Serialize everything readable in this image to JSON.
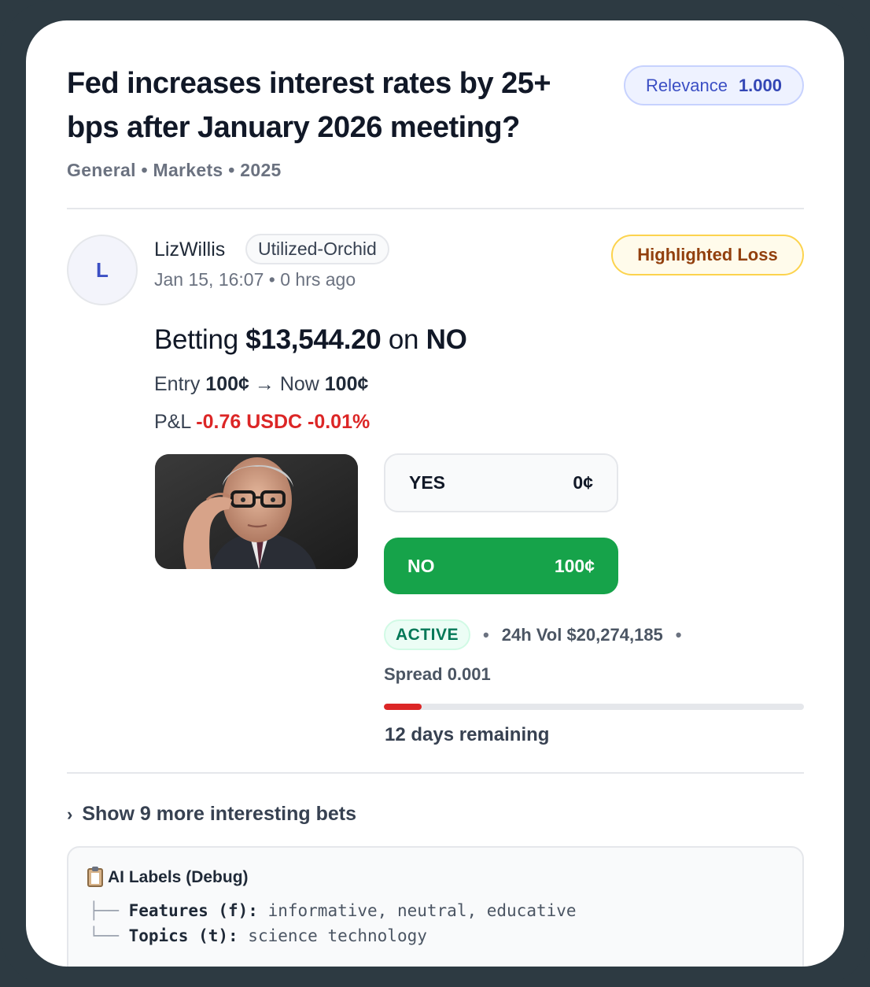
{
  "market": {
    "title": "Fed increases interest rates by 25+ bps after January 2026 meeting?",
    "relevance_label": "Relevance",
    "relevance_value": "1.000",
    "meta": "General • Markets • 2025"
  },
  "post": {
    "avatar_initial": "L",
    "username": "LizWillis",
    "user_tag": "Utilized-Orchid",
    "timestamp": "Jan 15, 16:07 • 0 hrs ago",
    "badge": "Highlighted Loss",
    "bet_prefix": "Betting ",
    "bet_amount": "$13,544.20",
    "bet_mid": " on ",
    "bet_side": "NO",
    "entry_label": "Entry ",
    "entry_value": "100¢",
    "arrow": " → Now ",
    "now_value": "100¢",
    "pnl_label": "P&L ",
    "pnl_value": "-0.76 USDC -0.01%"
  },
  "outcomes": [
    {
      "label": "YES",
      "price": "0¢"
    },
    {
      "label": "NO",
      "price": "100¢"
    }
  ],
  "stats": {
    "status": "ACTIVE",
    "volume": "24h Vol $20,274,185",
    "spread": "Spread 0.001",
    "time_elapsed_fraction": 0.09,
    "days_remaining": "12 days remaining"
  },
  "show_more": "Show 9 more interesting bets",
  "debug": {
    "title": "AI Labels (Debug)",
    "features_key": "Features (f):",
    "features_value": " informative, neutral, educative",
    "topics_key": "Topics (t):",
    "topics_value": " science technology"
  },
  "colors": {
    "accent": "#3b4fc4",
    "yes_bg": "#f9fafb",
    "no_bg": "#16a34a",
    "loss": "#dc2626",
    "frame": "#2d3a42"
  }
}
